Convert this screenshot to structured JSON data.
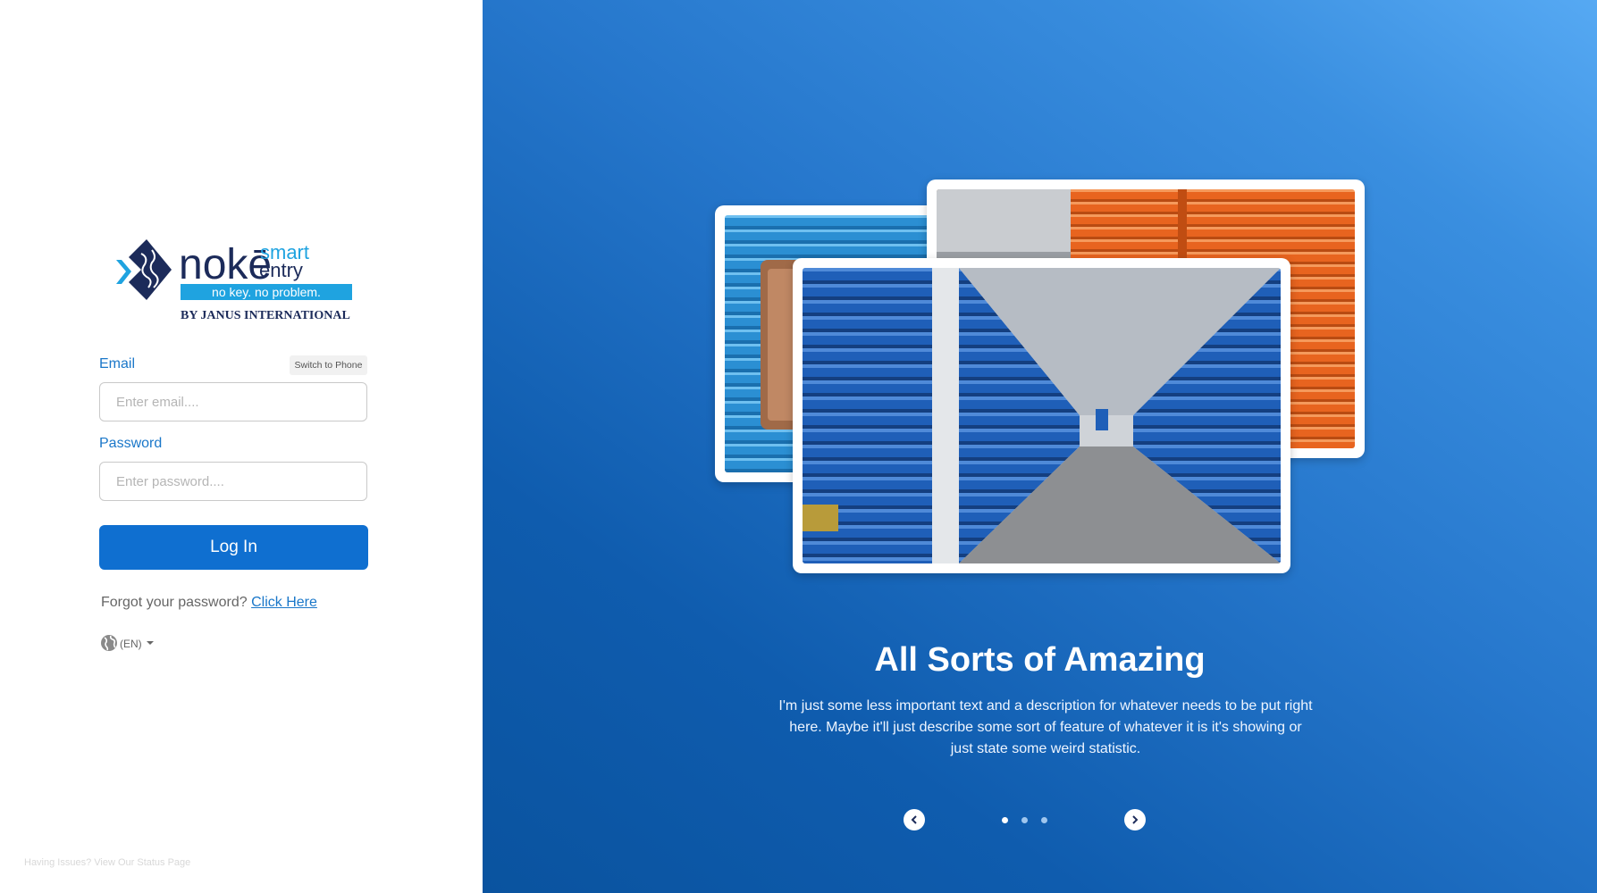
{
  "brand": {
    "logo_main": "nokē",
    "logo_smart": "smart",
    "logo_entry": "entry",
    "tagline": "no key. no problem.",
    "byline": "BY JANUS INTERNATIONAL"
  },
  "login": {
    "email_label": "Email",
    "switch_label": "Switch to Phone",
    "email_placeholder": "Enter email....",
    "password_label": "Password",
    "password_placeholder": "Enter password....",
    "login_button": "Log In",
    "forgot_text": "Forgot your password?",
    "forgot_link": "Click Here",
    "language": "(EN)",
    "status_link": "Having Issues? View Our Status Page"
  },
  "carousel": {
    "title": "All Sorts of Amazing",
    "description": "I'm just some less important text and a description for whatever needs to be put right here. Maybe it'll just describe some sort of feature of whatever it is it's showing or just state some weird statistic.",
    "current_slide": 1,
    "total_slides": 3
  },
  "colors": {
    "primary": "#0f6fd0",
    "label_blue": "#1a77c9",
    "logo_navy": "#1c2b5a",
    "logo_cyan": "#1fa3e0",
    "unit_orange": "#e8641f",
    "unit_blue": "#1f5fb8"
  }
}
